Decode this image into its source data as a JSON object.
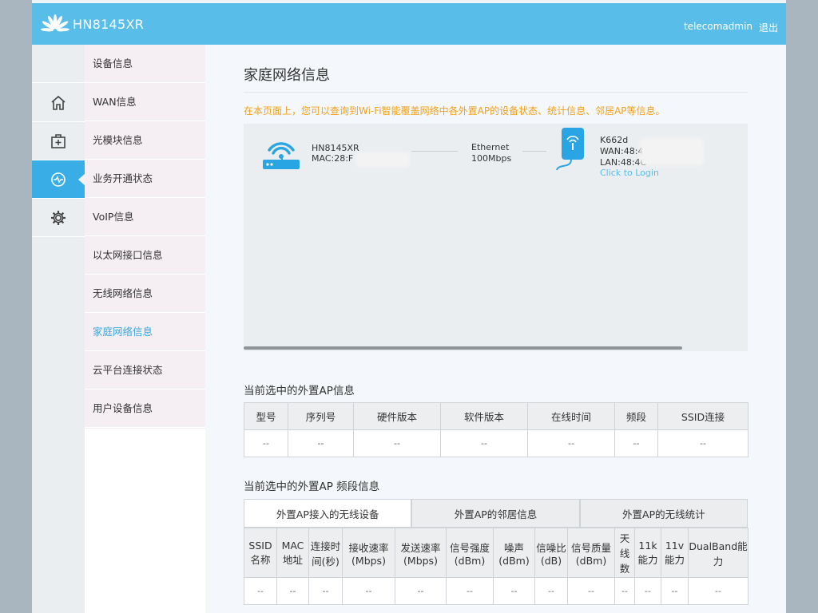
{
  "header": {
    "model": "HN8145XR",
    "user": "telecomadmin",
    "logout": "退出"
  },
  "nav_icons": [
    "home-icon",
    "first-aid-kit-icon",
    "monitor-status-icon",
    "gear-icon"
  ],
  "submenu": [
    {
      "label": "设备信息",
      "active": false
    },
    {
      "label": "WAN信息",
      "active": false
    },
    {
      "label": "光模块信息",
      "active": false
    },
    {
      "label": "业务开通状态",
      "active": false
    },
    {
      "label": "VoIP信息",
      "active": false
    },
    {
      "label": "以太网接口信息",
      "active": false
    },
    {
      "label": "无线网络信息",
      "active": false
    },
    {
      "label": "家庭网络信息",
      "active": true
    },
    {
      "label": "云平台连接状态",
      "active": false
    },
    {
      "label": "用户设备信息",
      "active": false
    }
  ],
  "page": {
    "title": "家庭网络信息",
    "notice": "在本页面上，您可以查询到Wi-Fi智能覆盖网络中各外置AP的设备状态、统计信息、邻居AP等信息。"
  },
  "topology": {
    "gateway": {
      "name": "HN8145XR",
      "mac": "MAC:28:F"
    },
    "link": {
      "type": "Ethernet",
      "speed": "100Mbps"
    },
    "ap": {
      "name": "K662d",
      "wan": "WAN:48:4C",
      "lan": "LAN:48:4C",
      "login": "Click to Login"
    }
  },
  "ap_info": {
    "title": "当前选中的外置AP信息",
    "headers": [
      "型号",
      "序列号",
      "硬件版本",
      "软件版本",
      "在线时间",
      "频段",
      "SSID连接"
    ],
    "row": [
      "--",
      "--",
      "--",
      "--",
      "--",
      "--",
      "--"
    ]
  },
  "band_info": {
    "title": "当前选中的外置AP 频段信息",
    "tabs": [
      "外置AP接入的无线设备",
      "外置AP的邻居信息",
      "外置AP的无线统计"
    ],
    "headers": [
      "SSID名称",
      "MAC地址",
      "连接时间(秒)",
      "接收速率(Mbps)",
      "发送速率(Mbps)",
      "信号强度(dBm)",
      "噪声(dBm)",
      "信噪比(dB)",
      "信号质量(dBm)",
      "天线数",
      "11k能力",
      "11v能力",
      "DualBand能力"
    ],
    "row": [
      "--",
      "--",
      "--",
      "--",
      "--",
      "--",
      "--",
      "--",
      "--",
      "--",
      "--",
      "--",
      "--"
    ]
  },
  "colors": {
    "header": "#59bdea",
    "active_nav": "#39aee6",
    "notice": "#f0a11a",
    "link": "#5bbce8"
  }
}
